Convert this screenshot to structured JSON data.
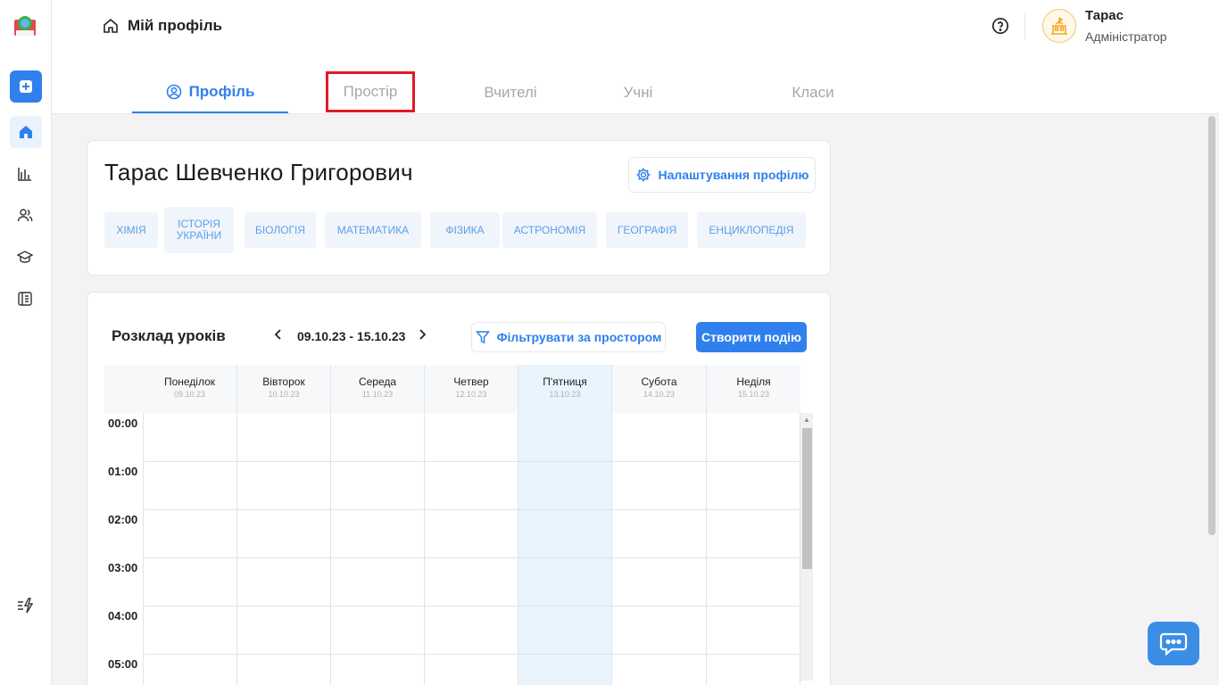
{
  "header": {
    "breadcrumb": "Мій профіль",
    "user_name": "Тарас",
    "user_role": "Адміністратор"
  },
  "tabs": [
    {
      "label": "Профіль",
      "active": true
    },
    {
      "label": "Простір",
      "active": false,
      "highlighted": true
    },
    {
      "label": "Вчителі",
      "active": false
    },
    {
      "label": "Учні",
      "active": false
    },
    {
      "label": "Класи",
      "active": false
    }
  ],
  "profile": {
    "full_name": "Тарас Шевченко Григорович",
    "settings_label": "Налаштування профілю",
    "subjects": [
      "ХІМІЯ",
      "ІСТОРІЯ УКРАЇНИ",
      "БІОЛОГІЯ",
      "МАТЕМАТИКА",
      "ФІЗИКА",
      "АСТРОНОМІЯ",
      "ГЕОГРАФІЯ",
      "ЕНЦИКЛОПЕДІЯ"
    ]
  },
  "schedule": {
    "title": "Розклад уроків",
    "week_range": "09.10.23 - 15.10.23",
    "prev": "‹",
    "next": "›",
    "filter_label": "Фільтрувати за простором",
    "create_label": "Створити подію",
    "days": [
      {
        "name": "Понеділок",
        "date": "09.10.23"
      },
      {
        "name": "Вівторок",
        "date": "10.10.23"
      },
      {
        "name": "Середа",
        "date": "11.10.23"
      },
      {
        "name": "Четвер",
        "date": "12.10.23"
      },
      {
        "name": "П'ятниця",
        "date": "13.10.23",
        "current": true
      },
      {
        "name": "Субота",
        "date": "14.10.23"
      },
      {
        "name": "Неділя",
        "date": "15.10.23"
      }
    ],
    "hours": [
      "00:00",
      "01:00",
      "02:00",
      "03:00",
      "04:00",
      "05:00"
    ]
  },
  "icons": {
    "logo": "school-logo-icon",
    "sidebar": [
      "plus-square-icon",
      "home-icon",
      "chart-icon",
      "users-icon",
      "graduation-cap-icon",
      "book-icon",
      "lightning-list-icon"
    ],
    "help": "question-circle-icon",
    "avatar": "school-building-icon",
    "chat": "chat-bubble-icon"
  },
  "colors": {
    "accent": "#2f80ed",
    "highlight_outline": "#e01b24",
    "current_day_bg": "#e9f4fd",
    "tag_bg": "#f0f5fb",
    "tag_text": "#5aa0ea"
  }
}
